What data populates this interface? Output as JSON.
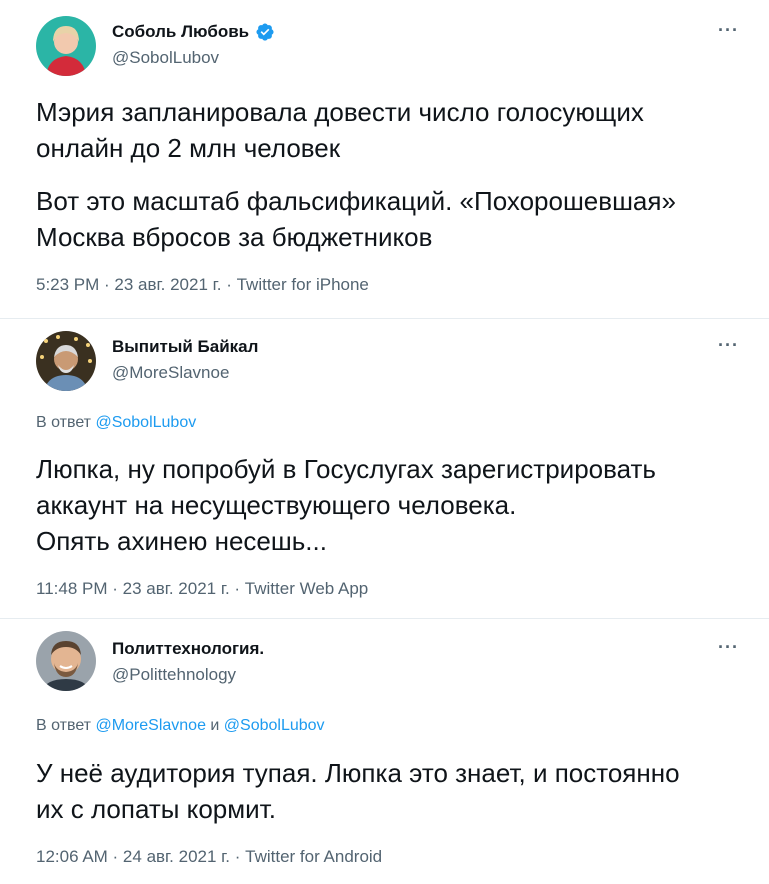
{
  "tweets": [
    {
      "name": "Соболь Любовь",
      "handle": "@SobolLubov",
      "verified": true,
      "paragraphs": [
        "Мэрия запланировала довести число голосующих онлайн до 2 млн человек",
        "Вот это масштаб фальсификаций. «Похорошевшая» Москва вбросов за бюджетников"
      ],
      "meta": "5:23 PM · 23 авг. 2021 г. · Twitter for iPhone",
      "more_label": "···"
    },
    {
      "name": "Выпитый Байкал",
      "handle": "@MoreSlavnoe",
      "reply_prefix": "В ответ ",
      "reply_mention1": "@SobolLubov",
      "lines": [
        "Люпка, ну попробуй в Госуслугах зарегистрировать",
        "аккаунт на несуществующего человека.",
        "Опять ахинею несешь..."
      ],
      "meta": "11:48 PM · 23 авг. 2021 г. · Twitter Web App",
      "more_label": "···"
    },
    {
      "name": "Политтехнология.",
      "handle": "@Polittehnology",
      "reply_prefix": "В ответ ",
      "reply_mention1": "@MoreSlavnoe",
      "reply_joiner": " и ",
      "reply_mention2": "@SobolLubov",
      "lines": [
        "У неё аудитория тупая. Люпка это знает, и постоянно",
        "их с лопаты кормит."
      ],
      "meta": "12:06 AM · 24 авг. 2021 г. · Twitter for Android",
      "more_label": "···"
    }
  ],
  "colors": {
    "accent": "#1d9bf0",
    "text": "#0f1419",
    "secondary": "#536471",
    "divider": "#e6ecf0"
  }
}
